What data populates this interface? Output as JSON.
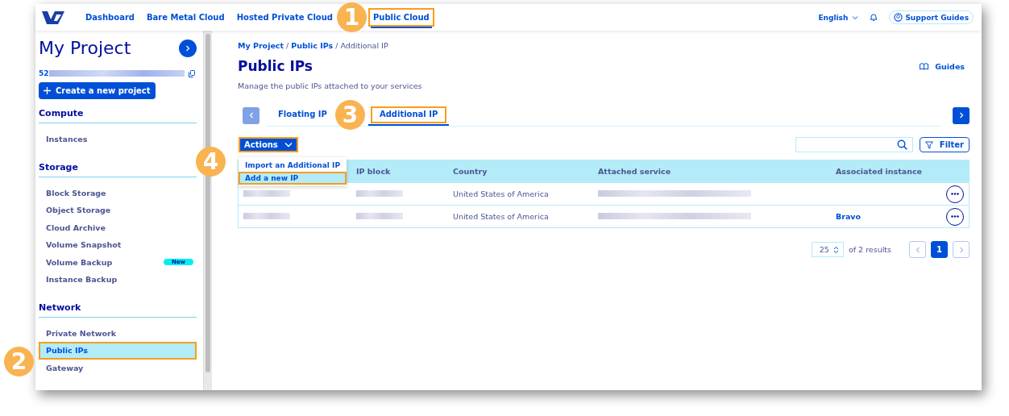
{
  "nav": {
    "items": [
      {
        "label": "Dashboard",
        "selected": false,
        "highlighted": false
      },
      {
        "label": "Bare Metal Cloud",
        "selected": false,
        "highlighted": false
      },
      {
        "label": "Hosted Private Cloud",
        "selected": false,
        "highlighted": false
      },
      {
        "label": "Public Cloud",
        "selected": true,
        "highlighted": true
      }
    ],
    "language": "English",
    "support": "Support Guides"
  },
  "sidebar": {
    "title": "My Project",
    "project_id": "52",
    "create_button": "Create a new project",
    "sections": [
      {
        "title": "Compute",
        "items": [
          {
            "label": "Instances",
            "selected": false,
            "highlighted": false
          }
        ]
      },
      {
        "title": "Storage",
        "items": [
          {
            "label": "Block Storage",
            "selected": false,
            "highlighted": false
          },
          {
            "label": "Object Storage",
            "selected": false,
            "highlighted": false
          },
          {
            "label": "Cloud Archive",
            "selected": false,
            "highlighted": false
          },
          {
            "label": "Volume Snapshot",
            "selected": false,
            "highlighted": false
          },
          {
            "label": "Volume Backup",
            "selected": false,
            "highlighted": false,
            "badge": "New"
          },
          {
            "label": "Instance Backup",
            "selected": false,
            "highlighted": false
          }
        ]
      },
      {
        "title": "Network",
        "items": [
          {
            "label": "Private Network",
            "selected": false,
            "highlighted": false
          },
          {
            "label": "Public IPs",
            "selected": true,
            "highlighted": true
          },
          {
            "label": "Gateway",
            "selected": false,
            "highlighted": false
          }
        ]
      }
    ]
  },
  "breadcrumb": [
    {
      "label": "My Project",
      "link": true,
      "separator": "/"
    },
    {
      "label": "Public IPs",
      "link": true,
      "separator": "/"
    },
    {
      "label": "Additional IP",
      "link": false
    }
  ],
  "page": {
    "title": "Public IPs",
    "subtitle": "Manage the public IPs attached to your services",
    "guides": "Guides"
  },
  "tabs": [
    {
      "label": "Floating IP",
      "selected": false,
      "highlighted": false
    },
    {
      "label": "Additional IP",
      "selected": true,
      "highlighted": true
    }
  ],
  "actions": {
    "label": "Actions",
    "highlighted": true,
    "menu": [
      {
        "label": "Import an Additional IP",
        "highlighted": false
      },
      {
        "label": "Add a new IP",
        "highlighted": true
      }
    ]
  },
  "filter": "Filter",
  "table": {
    "columns": [
      "IP block",
      "Country",
      "Attached service",
      "Associated instance"
    ],
    "rows": [
      {
        "cells": [
          {
            "kind": "redacted"
          },
          {
            "kind": "redacted"
          },
          {
            "kind": "text",
            "text": "United States of America"
          },
          {
            "kind": "redacted"
          },
          {
            "kind": "empty"
          }
        ]
      },
      {
        "cells": [
          {
            "kind": "redacted"
          },
          {
            "kind": "redacted"
          },
          {
            "kind": "text",
            "text": "United States of America"
          },
          {
            "kind": "redacted"
          },
          {
            "kind": "link",
            "text": "Bravo"
          }
        ]
      }
    ]
  },
  "pagination": {
    "page_size": "25",
    "summary": "of 2 results",
    "pages": [
      {
        "label": "1",
        "selected": true
      }
    ]
  },
  "annotations": [
    "1",
    "2",
    "3",
    "4"
  ]
}
